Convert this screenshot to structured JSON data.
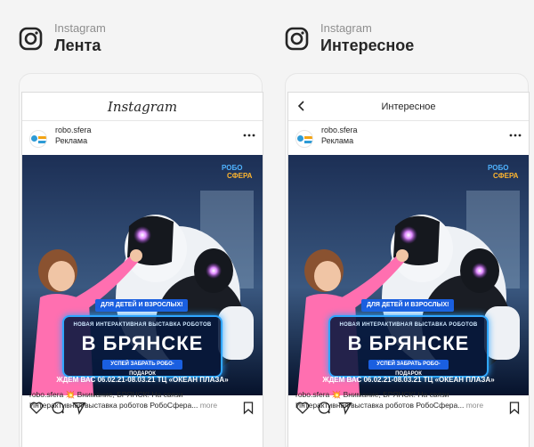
{
  "columns": [
    {
      "platform": "Instagram",
      "placement": "Лента",
      "app_title": "Instagram",
      "has_back": false,
      "account": "robo.sfera",
      "sponsored": "Реклама",
      "creative": {
        "brand_line1": "РОБО",
        "brand_line2": "СФЕРА",
        "tag": "ДЛЯ ДЕТЕЙ И ВЗРОСЛЫХ!",
        "subtitle": "НОВАЯ ИНТЕРАКТИВНАЯ ВЫСТАВКА РОБОТОВ",
        "city": "В БРЯНСКЕ",
        "gift": "УСПЕЙ ЗАБРАТЬ РОБО-ПОДАРОК",
        "dates": "ЖДЕМ ВАС 06.02.21-08.03.21 ТЦ «ОКЕАН ПЛАЗА»"
      },
      "caption_account": "robo.sfera",
      "caption_emoji": "💥",
      "caption_text": "Внимание, БРЯНСК! На связи",
      "caption_line2": "Интерактивная выставка роботов РобоСфера...",
      "caption_more": "more"
    },
    {
      "platform": "Instagram",
      "placement": "Интересное",
      "app_title": "Интересное",
      "has_back": true,
      "account": "robo.sfera",
      "sponsored": "Реклама",
      "creative": {
        "brand_line1": "РОБО",
        "brand_line2": "СФЕРА",
        "tag": "ДЛЯ ДЕТЕЙ И ВЗРОСЛЫХ!",
        "subtitle": "НОВАЯ ИНТЕРАКТИВНАЯ ВЫСТАВКА РОБОТОВ",
        "city": "В БРЯНСКЕ",
        "gift": "УСПЕЙ ЗАБРАТЬ РОБО-ПОДАРОК",
        "dates": "ЖДЕМ ВАС 06.02.21-08.03.21 ТЦ «ОКЕАН ПЛАЗА»"
      },
      "caption_account": "robo.sfera",
      "caption_emoji": "💥",
      "caption_text": "Внимание, БРЯНСК! На связи",
      "caption_line2": "Интерактивная выставка роботов РобоСфера...",
      "caption_more": "more"
    }
  ],
  "icons": {
    "platform": "instagram-icon",
    "back": "chevron-left-icon",
    "more": "more-icon",
    "like": "heart-icon",
    "comment": "comment-icon",
    "share": "send-icon",
    "save": "bookmark-icon"
  }
}
